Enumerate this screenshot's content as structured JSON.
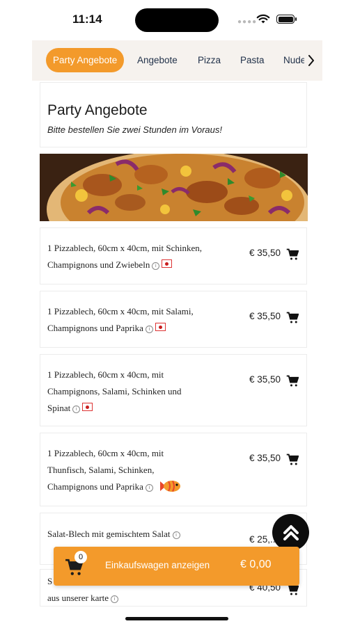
{
  "status_bar": {
    "time": "11:14"
  },
  "tabs": [
    {
      "label": "Party Angebote",
      "active": true
    },
    {
      "label": "Angebote"
    },
    {
      "label": "Pizza"
    },
    {
      "label": "Pasta"
    },
    {
      "label": "Nude"
    }
  ],
  "category": {
    "title": "Party Angebote",
    "subtitle": "Bitte bestellen Sie zwei Stunden im Voraus!"
  },
  "items": [
    {
      "line1": " 1 Pizzablech, 60cm x 40cm, mit Schinken,",
      "line2": "Champignons und Zwiebeln",
      "price": "€ 35,50"
    },
    {
      "line1": " 1 Pizzablech, 60cm x 40cm, mit Salami,",
      "line2": "Champignons und Paprika",
      "price": "€ 35,50"
    },
    {
      "line1": " 1 Pizzablech, 60cm x 40cm, mit",
      "line2": "Champignons, Salami, Schinken und",
      "line3": "Spinat",
      "price": "€ 35,50"
    },
    {
      "line1": " 1 Pizzablech, 60cm x 40cm, mit",
      "line2": "Thunfisch, Salami, Schinken,",
      "line3": "Champignons und Paprika",
      "price": "€ 35,50"
    },
    {
      "line1": "Salat-Blech mit gemischtem Salat",
      "price": "€ 25,..."
    },
    {
      "line1": "S",
      "line2": "aus unserer karte",
      "price": "€ 40,50"
    }
  ],
  "cart": {
    "count": "0",
    "label": "Einkaufswagen anzeigen",
    "total": "€ 0,00"
  },
  "colors": {
    "accent": "#f39a2b",
    "tab_bar_bg": "#f6f2ee",
    "text": "#1c1c1c"
  }
}
